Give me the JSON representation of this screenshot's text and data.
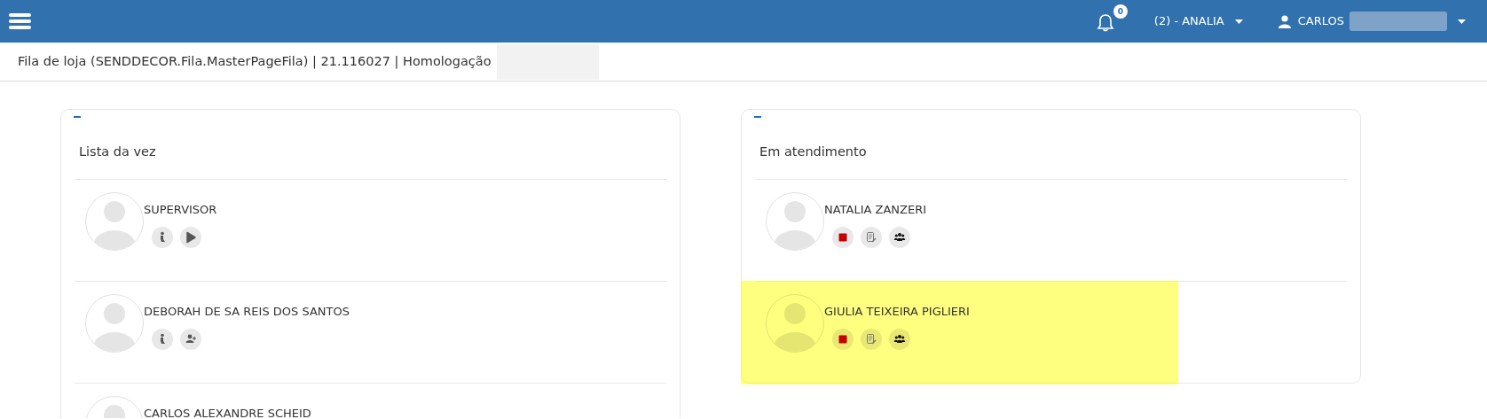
{
  "navbar": {
    "notifications": {
      "count": "0"
    },
    "store": "(2) - ANALIA",
    "user": "CARLOS"
  },
  "breadcrumb": "Fila de loja (SENDDECOR.Fila.MasterPageFila) | 21.116027 | Homologação",
  "panels": [
    {
      "title": "Lista da vez",
      "items": [
        {
          "name": "SUPERVISOR",
          "highlighted": false,
          "actions": [
            {
              "kind": "walk"
            },
            {
              "kind": "play"
            }
          ]
        },
        {
          "name": "DEBORAH DE SA REIS DOS SANTOS",
          "highlighted": false,
          "actions": [
            {
              "kind": "walk"
            },
            {
              "kind": "add-user"
            }
          ]
        },
        {
          "name": "CARLOS ALEXANDRE SCHEID",
          "highlighted": false
        }
      ]
    },
    {
      "title": "Em atendimento",
      "items": [
        {
          "name": "NATALIA ZANZERI",
          "highlighted": false,
          "actions": [
            {
              "kind": "stop"
            },
            {
              "kind": "notes"
            },
            {
              "kind": "group"
            }
          ]
        },
        {
          "name": "GIULIA TEIXEIRA PIGLIERI",
          "highlighted": true,
          "actions": [
            {
              "kind": "stop"
            },
            {
              "kind": "notes"
            },
            {
              "kind": "group"
            }
          ]
        }
      ]
    }
  ]
}
